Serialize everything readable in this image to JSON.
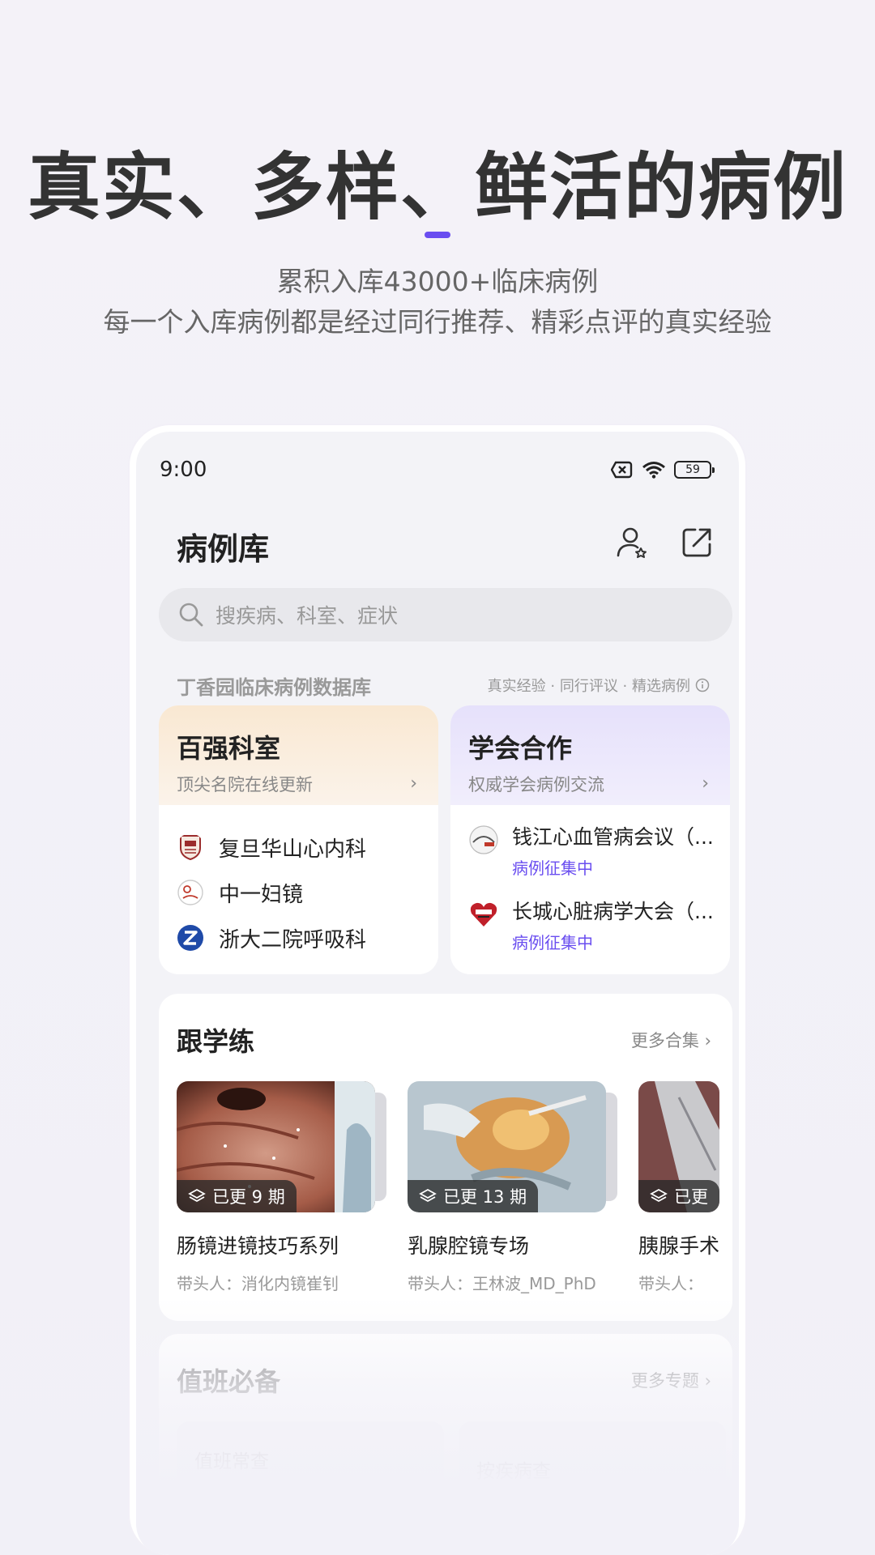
{
  "promo": {
    "headline": "真实、多样、鲜活的病例",
    "subline1": "累积入库43000+临床病例",
    "subline2": "每一个入库病例都是经过同行推荐、精彩点评的真实经验",
    "accent_color": "#6a4ef0"
  },
  "status_bar": {
    "time": "9:00",
    "battery": "59",
    "icons": [
      "no-sim-icon",
      "wifi-icon",
      "battery-icon"
    ]
  },
  "header": {
    "title": "病例库",
    "icons": [
      "user-star-icon",
      "share-icon"
    ]
  },
  "search": {
    "placeholder": "搜疾病、科室、症状"
  },
  "database": {
    "title": "丁香园临床病例数据库",
    "tags": "真实经验 · 同行评议 · 精选病例"
  },
  "top_departments": {
    "title": "百强科室",
    "subtitle": "顶尖名院在线更新",
    "items": [
      {
        "name": "复旦华山心内科"
      },
      {
        "name": "中一妇镜"
      },
      {
        "name": "浙大二院呼吸科"
      }
    ]
  },
  "associations": {
    "title": "学会合作",
    "subtitle": "权威学会病例交流",
    "items": [
      {
        "name": "钱江心血管病会议（...",
        "tag": "病例征集中"
      },
      {
        "name": "长城心脏病学大会（...",
        "tag": "病例征集中"
      }
    ]
  },
  "follow_learn": {
    "title": "跟学练",
    "more": "更多合集",
    "videos": [
      {
        "badge": "已更 9 期",
        "title": "肠镜进镜技巧系列",
        "lead": "带头人：消化内镜崔钊"
      },
      {
        "badge": "已更 13 期",
        "title": "乳腺腔镜专场",
        "lead": "带头人：王林波_MD_PhD"
      },
      {
        "badge": "已更",
        "title": "胰腺手术",
        "lead": "带头人："
      }
    ]
  },
  "on_duty": {
    "title": "值班必备",
    "more": "更多专题",
    "cards": [
      "值班常查",
      "按疾病查"
    ]
  }
}
